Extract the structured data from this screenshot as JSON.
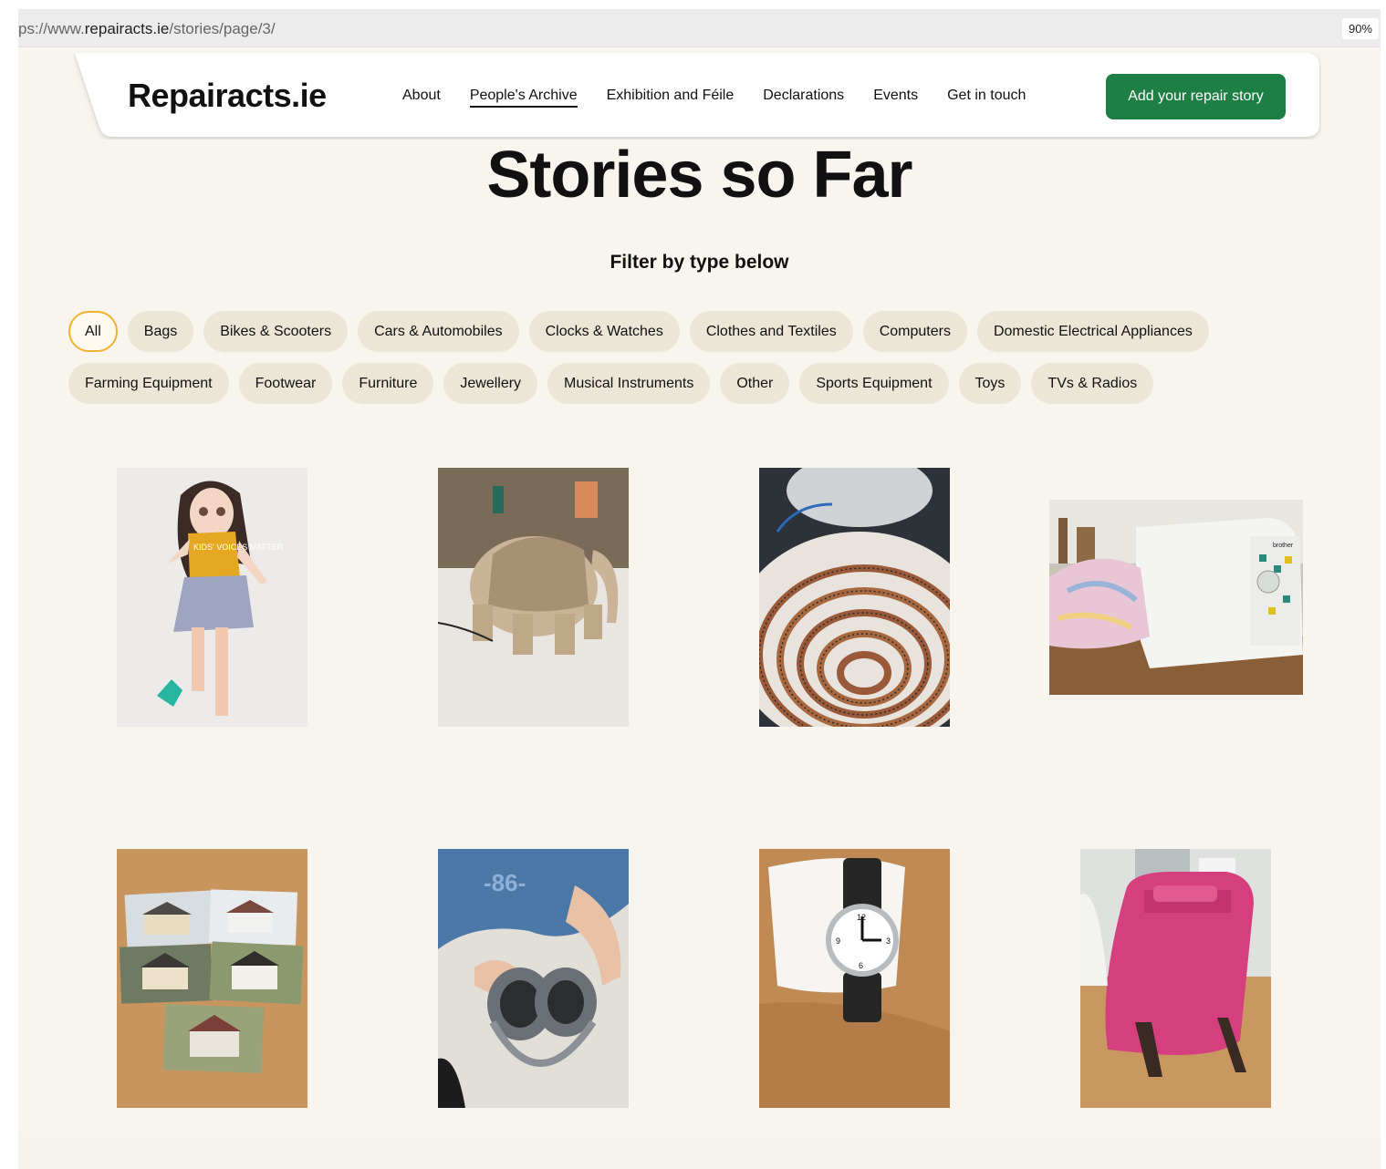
{
  "browser": {
    "url_prefix": "ps://www.",
    "url_domain": "repairacts.ie",
    "url_path": "/stories/page/3/",
    "zoom": "90%"
  },
  "header": {
    "logo": "Repairacts.ie",
    "nav": [
      "About",
      "People's Archive",
      "Exhibition and Féile",
      "Declarations",
      "Events",
      "Get in touch"
    ],
    "active_nav": "People's Archive",
    "cta": "Add your repair story",
    "cta_color": "#1e7f44"
  },
  "main": {
    "title": "Stories so Far",
    "filter_heading": "Filter by type below",
    "filters_row1": [
      "All",
      "Bags",
      "Bikes & Scooters",
      "Cars & Automobiles",
      "Clocks & Watches",
      "Clothes and Textiles",
      "Computers",
      "Domestic Electrical Appliances"
    ],
    "filters_row2": [
      "Farming Equipment",
      "Footwear",
      "Furniture",
      "Jewellery",
      "Musical Instruments",
      "Other",
      "Sports Equipment",
      "Toys",
      "TVs & Radios"
    ],
    "active_filter": "All",
    "active_filter_color": "#f0b232",
    "stories": [
      {
        "image": "doll",
        "text": "KIDS' VOICES MATTER"
      },
      {
        "image": "elephant-ornament"
      },
      {
        "image": "heating-element-coil"
      },
      {
        "image": "sewing-machine",
        "brand": "brother"
      },
      {
        "image": "cottage-photographs"
      },
      {
        "image": "headphones",
        "shirt_text": "-86-"
      },
      {
        "image": "wristwatch"
      },
      {
        "image": "pink-tablet-case"
      }
    ]
  }
}
